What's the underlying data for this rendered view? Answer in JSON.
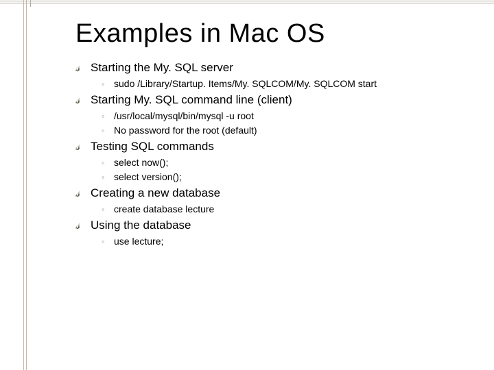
{
  "title": "Examples in Mac OS",
  "items": [
    {
      "label": "Starting the My. SQL server",
      "subs": [
        "sudo /Library/Startup. Items/My. SQLCOM/My. SQLCOM start"
      ]
    },
    {
      "label": "Starting My. SQL command line (client)",
      "subs": [
        "/usr/local/mysql/bin/mysql -u root",
        "No password for the root (default)"
      ]
    },
    {
      "label": "Testing SQL commands",
      "subs": [
        "select now();",
        "select version();"
      ]
    },
    {
      "label": "Creating a new database",
      "subs": [
        "create database lecture"
      ]
    },
    {
      "label": "Using the database",
      "subs": [
        "use lecture;"
      ]
    }
  ]
}
